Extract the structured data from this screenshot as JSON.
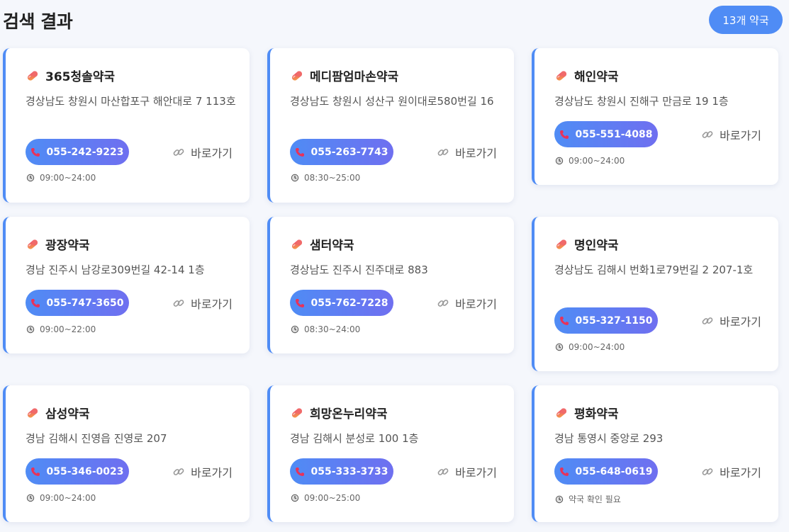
{
  "header": {
    "title": "검색 결과",
    "count_label": "13개 약국"
  },
  "pharmacies": [
    {
      "name": "365청솔약국",
      "address": "경상남도 창원시 마산합포구 해안대로 7 113호",
      "phone": "055-242-9223",
      "link_label": "바로가기",
      "hours": "09:00~24:00"
    },
    {
      "name": "메디팜엄마손약국",
      "address": "경상남도 창원시 성산구 원이대로580번길 16",
      "phone": "055-263-7743",
      "link_label": "바로가기",
      "hours": "08:30~25:00"
    },
    {
      "name": "해인약국",
      "address": "경상남도 창원시 진해구 만금로 19 1층",
      "phone": "055-551-4088",
      "link_label": "바로가기",
      "hours": "09:00~24:00"
    },
    {
      "name": "광장약국",
      "address": "경남 진주시 남강로309번길 42-14 1층",
      "phone": "055-747-3650",
      "link_label": "바로가기",
      "hours": "09:00~22:00"
    },
    {
      "name": "샘터약국",
      "address": "경상남도 진주시 진주대로 883",
      "phone": "055-762-7228",
      "link_label": "바로가기",
      "hours": "08:30~24:00"
    },
    {
      "name": "명인약국",
      "address": "경상남도 김해시 번화1로79번길 2 207-1호",
      "phone": "055-327-1150",
      "link_label": "바로가기",
      "hours": "09:00~24:00"
    },
    {
      "name": "삼성약국",
      "address": "경남 김해시 진영읍 진영로 207",
      "phone": "055-346-0023",
      "link_label": "바로가기",
      "hours": "09:00~24:00"
    },
    {
      "name": "희망온누리약국",
      "address": "경남 김해시 분성로 100 1층",
      "phone": "055-333-3733",
      "link_label": "바로가기",
      "hours": "09:00~25:00"
    },
    {
      "name": "평화약국",
      "address": "경남 통영시 중앙로 293",
      "phone": "055-648-0619",
      "link_label": "바로가기",
      "hours": "약국 확인 필요"
    }
  ]
}
